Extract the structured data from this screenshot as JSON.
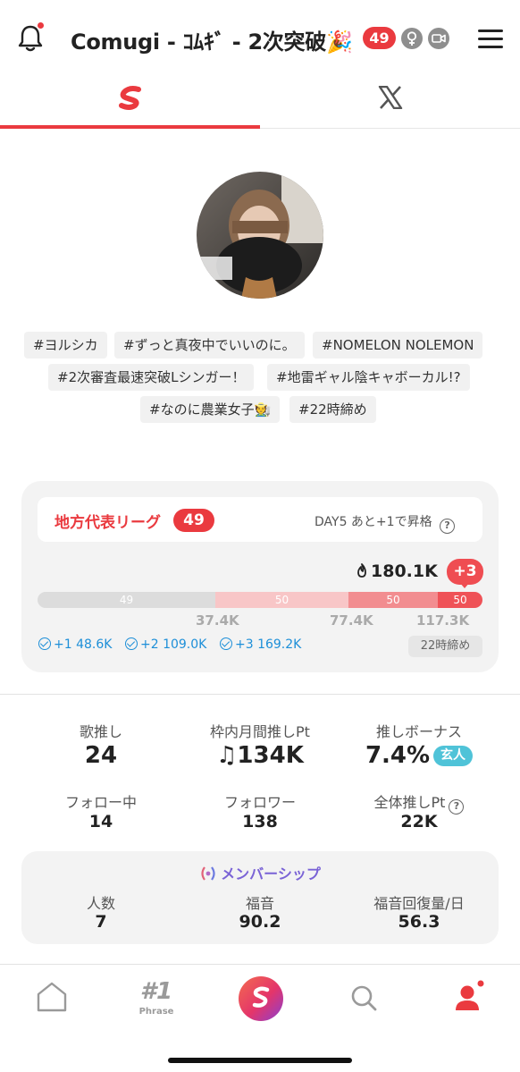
{
  "header": {
    "title": "Comugi - ｺﾑｷﾞ -  2次突破🎉",
    "rank_badge": "49",
    "icons": [
      "bell-icon",
      "venus-icon",
      "video-icon",
      "menu-icon"
    ]
  },
  "tabs": [
    {
      "name": "tab-sounds",
      "icon": "s-logo-icon",
      "active": true
    },
    {
      "name": "tab-x",
      "icon": "x-logo-icon",
      "active": false
    }
  ],
  "tags": [
    "#ヨルシカ",
    "#ずっと真夜中でいいのに。",
    "#NOMELON NOLEMON",
    "#2次審査最速突破Lシンガー！",
    "#地雷ギャル陰キャボーカル!?",
    "#なのに農業女子🧑‍🌾",
    "#22時締め"
  ],
  "league": {
    "title": "地方代表リーグ",
    "badge": "49",
    "day_info": "DAY5 あと+1で昇格",
    "help": "?",
    "current_value": "180.1K",
    "plus_badge": "+3",
    "segments": [
      {
        "label": "49",
        "color": "#dcdcdc",
        "fraction": 0.4
      },
      {
        "label": "50",
        "color": "#f8c6c7",
        "fraction": 0.3
      },
      {
        "label": "50",
        "color": "#f28d90",
        "fraction": 0.2
      },
      {
        "label": "50",
        "color": "#ef5257",
        "fraction": 0.1
      }
    ],
    "thresholds": [
      "37.4K",
      "77.4K",
      "117.3K"
    ],
    "goals": [
      "+1 48.6K",
      "+2 109.0K",
      "+3 169.2K"
    ],
    "deadline": "22時締め"
  },
  "stats": {
    "uta_oshi": {
      "label": "歌推し",
      "value": "24"
    },
    "monthly_pt": {
      "label": "枠内月間推しPt",
      "value": "♫134K"
    },
    "bonus": {
      "label": "推しボーナス",
      "value": "7.4%",
      "badge": "玄人"
    },
    "following": {
      "label": "フォロー中",
      "value": "14"
    },
    "followers": {
      "label": "フォロワー",
      "value": "138"
    },
    "total_pt": {
      "label": "全体推しPt",
      "value": "22K",
      "help": "?"
    }
  },
  "membership": {
    "title": "メンバーシップ",
    "members": {
      "label": "人数",
      "value": "7"
    },
    "fukuon": {
      "label": "福音",
      "value": "90.2"
    },
    "recovery": {
      "label": "福音回復量/日",
      "value": "56.3"
    }
  },
  "nav": {
    "phrase_rank": "#1",
    "phrase_label": "Phrase"
  },
  "colors": {
    "accent": "#ea3a3f",
    "goal_blue": "#1d8fd8",
    "membership_purple": "#7a63d6",
    "badge_cyan": "#4fc3d8"
  }
}
